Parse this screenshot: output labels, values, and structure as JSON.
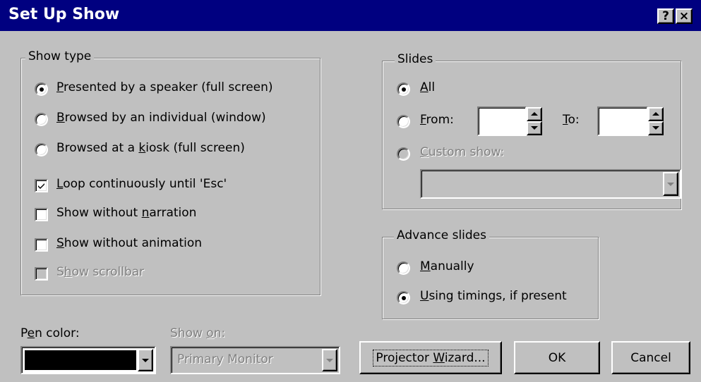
{
  "window": {
    "title": "Set Up Show",
    "help_button": "?",
    "close_button": "×"
  },
  "show_type": {
    "title": "Show type",
    "options": [
      {
        "pre": "",
        "key": "P",
        "post": "resented by a speaker (full screen)",
        "selected": true
      },
      {
        "pre": "",
        "key": "B",
        "post": "rowsed by an individual (window)",
        "selected": false
      },
      {
        "pre": "Browsed at a ",
        "key": "k",
        "post": "iosk (full screen)",
        "selected": false
      }
    ],
    "checks": [
      {
        "pre": "",
        "key": "L",
        "post": "oop continuously until 'Esc'",
        "checked": true,
        "enabled": true
      },
      {
        "pre": "Show without ",
        "key": "n",
        "post": "arration",
        "checked": false,
        "enabled": true
      },
      {
        "pre": "",
        "key": "S",
        "post": "how without animation",
        "checked": false,
        "enabled": true
      },
      {
        "pre": "S",
        "key": "h",
        "post": "ow scrollbar",
        "checked": false,
        "enabled": false
      }
    ]
  },
  "slides": {
    "title": "Slides",
    "all": {
      "key": "A",
      "post": "ll",
      "selected": true
    },
    "from": {
      "key": "F",
      "post": "rom:",
      "value": ""
    },
    "to": {
      "key": "T",
      "post": "o:",
      "value": ""
    },
    "custom": {
      "key": "C",
      "post": "ustom show:",
      "enabled": false,
      "value": ""
    }
  },
  "advance": {
    "title": "Advance slides",
    "manual": {
      "key": "M",
      "post": "anually",
      "selected": false
    },
    "timings": {
      "key": "U",
      "post": "sing timings, if present",
      "selected": true
    }
  },
  "pen": {
    "pre": "P",
    "key": "e",
    "post": "n color:",
    "color": "#000000"
  },
  "show_on": {
    "pre": "Show ",
    "key": "o",
    "post": "n:",
    "value": "Primary Monitor",
    "enabled": false
  },
  "buttons": {
    "projector": {
      "pre": "Projector ",
      "key": "W",
      "post": "izard..."
    },
    "ok": "OK",
    "cancel": "Cancel"
  }
}
